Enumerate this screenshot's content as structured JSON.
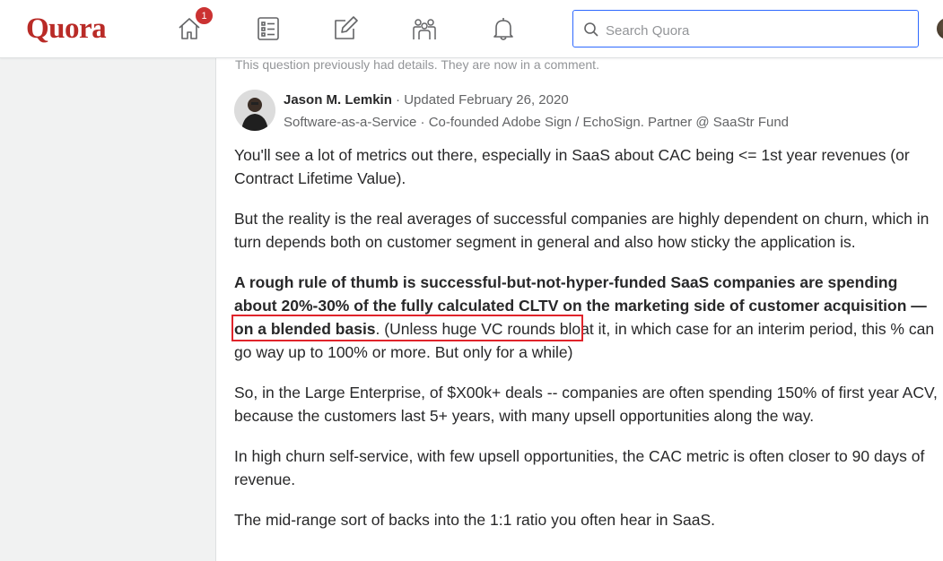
{
  "header": {
    "logo": "Quora",
    "notification_count": "1",
    "search": {
      "placeholder": "Search Quora",
      "value": ""
    },
    "nav": [
      "home-icon",
      "answer-list-icon",
      "write-icon",
      "spaces-icon",
      "notifications-icon"
    ],
    "colors": {
      "brand": "#b92b27",
      "badge": "#cb3232",
      "search_border": "#2e69ff"
    }
  },
  "question": {
    "previous_details_note": "This question previously had details. They are now in a comment."
  },
  "answer": {
    "author": "Jason M. Lemkin",
    "separator": " · ",
    "updated": "Updated February 26, 2020",
    "credential": "Software-as-a-Service · Co-founded Adobe Sign / EchoSign. Partner @ SaaStr Fund",
    "paragraphs": {
      "p1": "You'll see a lot of metrics out there, especially in SaaS about CAC being <= 1st year revenues (or Contract Lifetime Value).",
      "p2": "But the reality is the real averages of successful companies are highly dependent on churn, which in turn depends both on customer segment in general and also how sticky the application is.",
      "p3_bold": "A rough rule of thumb is successful-but-not-hyper-funded SaaS companies are spending about 20%-30% of the fully calculated CLTV on the marketing side of customer acquisition — on a blended basis",
      "p3_rest": ". (Unless huge VC rounds bloat it, in which case for an interim period, this % can go way up to 100% or more. But only for a while)",
      "p4": "So, in the Large Enterprise, of $X00k+ deals -- companies are often spending 150% of first year ACV, because the customers last 5+ years, with many upsell opportunities along the way.",
      "p5": "In high churn self-service, with few upsell opportunities, the CAC metric is often closer to 90 days of revenue.",
      "p6": "The mid-range sort of backs into the 1:1 ratio you often hear in SaaS."
    },
    "highlight_color": "#e0242b"
  }
}
